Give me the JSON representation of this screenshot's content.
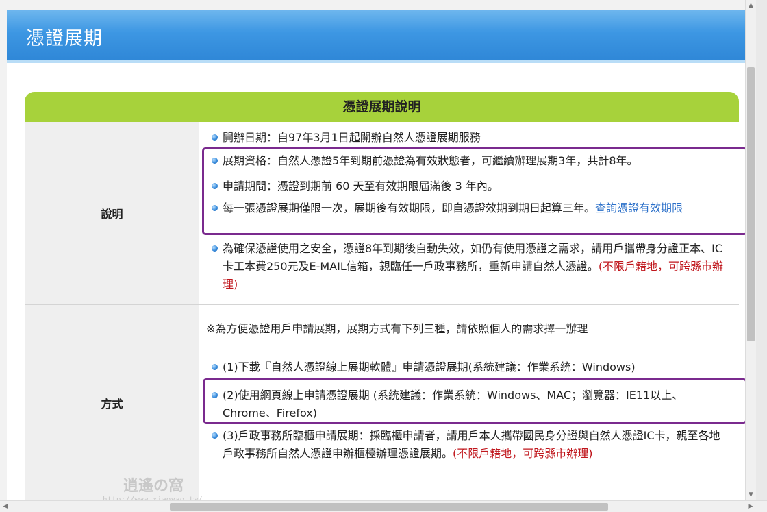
{
  "header": {
    "title": "憑證展期"
  },
  "panel": {
    "title": "憑證展期說明",
    "rows": [
      {
        "label": "說明",
        "items": [
          {
            "text": "開辦日期：自97年3月1日起開辦自然人憑證展期服務"
          },
          {
            "text": "展期資格：自然人憑證5年到期前憑證為有效狀態者，可繼續辦理展期3年，共計8年。"
          },
          {
            "text": "申請期間：憑證到期前 60 天至有效期限屆滿後 3 年內。"
          },
          {
            "text": "每一張憑證展期僅限一次，展期後有效期限，即自憑證效期到期日起算三年。",
            "link": "查詢憑證有效期限"
          },
          {
            "text": "為確保憑證使用之安全，憑證8年到期後自動失效，如仍有使用憑證之需求，請用戶攜帶身分證正本、IC卡工本費250元及E-MAIL信箱，親臨任一戶政事務所，重新申請自然人憑證。",
            "red": "(不限戶籍地，可跨縣市辦理)"
          }
        ]
      },
      {
        "label": "方式",
        "note": "※為方便憑證用戶申請展期，展期方式有下列三種，請依照個人的需求擇一辦理",
        "items": [
          {
            "text": "(1)下載『自然人憑證線上展期軟體』申請憑證展期(系統建議：作業系統：Windows)"
          },
          {
            "text": "(2)使用網頁線上申請憑證展期 (系統建議：作業系統：Windows、MAC；瀏覽器：IE11以上、Chrome、Firefox)"
          },
          {
            "text": "(3)戶政事務所臨櫃申請展期：採臨櫃申請者，請用戶本人攜帶國民身分證與自然人憑證IC卡，親至各地戶政事務所自然人憑證申辦櫃檯辦理憑證展期。",
            "red": "(不限戶籍地，可跨縣市辦理)"
          }
        ]
      }
    ]
  },
  "colors": {
    "header_blue": "#3d97e3",
    "panel_green": "#a7d23b",
    "highlight_purple": "#7a2a8e",
    "link_blue": "#2a6fc9",
    "note_red": "#c0161c"
  }
}
